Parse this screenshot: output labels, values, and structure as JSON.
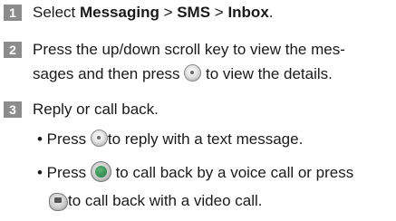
{
  "steps": [
    {
      "number": "1",
      "pre": "Select ",
      "menu1": "Messaging",
      "sep1": " > ",
      "menu2": "SMS",
      "sep2": " > ",
      "menu3": "Inbox",
      "end": "."
    },
    {
      "number": "2",
      "line1": "Press the up/down scroll key to view the mes-",
      "line2_pre": "sages and then press ",
      "line2_post": " to view the details."
    },
    {
      "number": "3",
      "line1": "Reply or call back.",
      "bullet1_pre": "• Press ",
      "bullet1_post": "to reply with a text message.",
      "bullet2_pre": "• Press ",
      "bullet2_post": " to call back by a voice call or press",
      "bullet2_cont": "to call back with a video call."
    }
  ],
  "icons": {
    "ok_key": "ok-key-icon",
    "send_key": "call-key-icon",
    "video_key": "video-call-key-icon"
  },
  "colors": {
    "step_badge": "#8c8c8c",
    "send_key_green": "#1f7a3d"
  }
}
